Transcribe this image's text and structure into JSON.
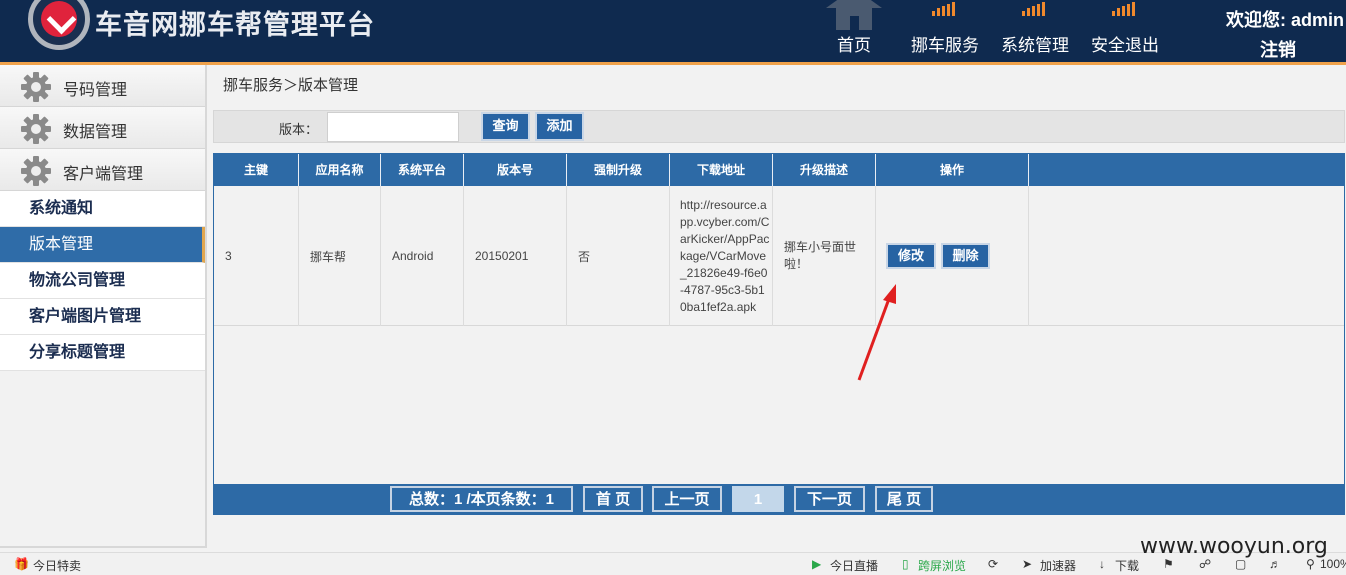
{
  "header": {
    "title": "车音网挪车帮管理平台",
    "nav": [
      {
        "label": "首页",
        "icon": "home-icon"
      },
      {
        "label": "挪车服务",
        "icon": "bar-chart-icon"
      },
      {
        "label": "系统管理",
        "icon": "bar-chart-icon"
      },
      {
        "label": "安全退出",
        "icon": "bar-chart-icon"
      }
    ],
    "welcome": "欢迎您: admin",
    "logout": "注销"
  },
  "sidebar": {
    "groups": [
      {
        "label": "号码管理",
        "icon": "gear-icon"
      },
      {
        "label": "数据管理",
        "icon": "gear-icon"
      },
      {
        "label": "客户端管理",
        "icon": "gear-icon"
      }
    ],
    "items": [
      {
        "label": "系统通知"
      },
      {
        "label": "版本管理",
        "active": true
      },
      {
        "label": "物流公司管理"
      },
      {
        "label": "客户端图片管理"
      },
      {
        "label": "分享标题管理"
      }
    ]
  },
  "breadcrumb": "挪车服务＞版本管理",
  "filter": {
    "label": "版本：",
    "value": "",
    "query_label": "查询",
    "add_label": "添加"
  },
  "table": {
    "headers": [
      "主键",
      "应用名称",
      "系统平台",
      "版本号",
      "强制升级",
      "下载地址",
      "升级描述",
      "操作"
    ],
    "rows": [
      {
        "id": "3",
        "app_name": "挪车帮",
        "platform": "Android",
        "version": "20150201",
        "force": "否",
        "url": "http://resource.app.vcyber.com/CarKicker/AppPackage/VCarMove_21826e49-f6e0-4787-95c3-5b10ba1fef2a.apk",
        "desc": "挪车小号面世啦！",
        "edit_label": "修改",
        "delete_label": "删除"
      }
    ]
  },
  "pager": {
    "summary": "总数：1 /本页条数：1",
    "first": "首 页",
    "prev": "上一页",
    "current": "1",
    "next": "下一页",
    "last": "尾 页"
  },
  "statusbar": {
    "left": "今日特卖",
    "items": [
      "今日直播",
      "跨屏浏览",
      "加速器",
      "下载"
    ],
    "zoom": "100%"
  },
  "watermark": "www.wooyun.org",
  "colors": {
    "header_bg": "#0f2a4f",
    "accent_blue": "#2d6aa6",
    "accent_orange": "#f0a24b",
    "logo_red": "#e0233c",
    "annotation_arrow": "#e02020"
  }
}
